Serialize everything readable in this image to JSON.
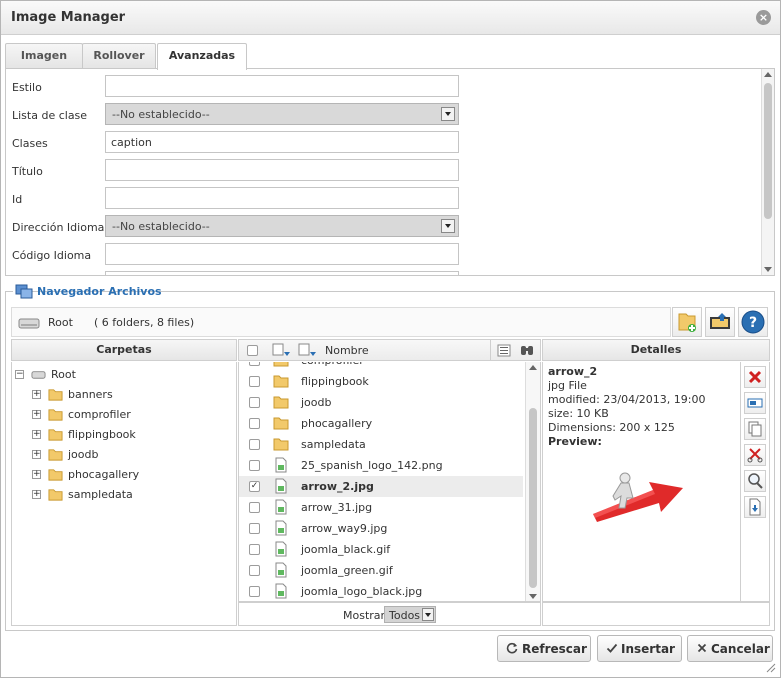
{
  "window": {
    "title": "Image Manager",
    "close_glyph": "×"
  },
  "tabs": [
    {
      "label": "Imagen"
    },
    {
      "label": "Rollover"
    },
    {
      "label": "Avanzadas"
    }
  ],
  "advanced": {
    "style_label": "Estilo",
    "style_value": "",
    "class_list_label": "Lista de clase",
    "class_list_value": "--No establecido--",
    "classes_label": "Clases",
    "classes_value": "caption",
    "title_label": "Título",
    "title_value": "",
    "id_label": "Id",
    "id_value": "",
    "lang_dir_label": "Dirección Idioma",
    "lang_dir_value": "--No establecido--",
    "lang_code_label": "Código Idioma",
    "lang_code_value": ""
  },
  "browser": {
    "legend": "Navegador Archivos",
    "path_name": "Root",
    "path_count": "( 6 folders, 8 files)"
  },
  "columns": {
    "folders": "Carpetas",
    "name": "Nombre",
    "details": "Detalles"
  },
  "tree": {
    "root": "Root",
    "folders": [
      "banners",
      "comprofiler",
      "flippingbook",
      "joodb",
      "phocagallery",
      "sampledata"
    ]
  },
  "files": [
    {
      "name": "comprofiler",
      "kind": "folder",
      "checked": false,
      "selected": false
    },
    {
      "name": "flippingbook",
      "kind": "folder",
      "checked": false,
      "selected": false
    },
    {
      "name": "joodb",
      "kind": "folder",
      "checked": false,
      "selected": false
    },
    {
      "name": "phocagallery",
      "kind": "folder",
      "checked": false,
      "selected": false
    },
    {
      "name": "sampledata",
      "kind": "folder",
      "checked": false,
      "selected": false
    },
    {
      "name": "25_spanish_logo_142.png",
      "kind": "image",
      "checked": false,
      "selected": false
    },
    {
      "name": "arrow_2.jpg",
      "kind": "image",
      "checked": true,
      "selected": true
    },
    {
      "name": "arrow_31.jpg",
      "kind": "image",
      "checked": false,
      "selected": false
    },
    {
      "name": "arrow_way9.jpg",
      "kind": "image",
      "checked": false,
      "selected": false
    },
    {
      "name": "joomla_black.gif",
      "kind": "image",
      "checked": false,
      "selected": false
    },
    {
      "name": "joomla_green.gif",
      "kind": "image",
      "checked": false,
      "selected": false
    },
    {
      "name": "joomla_logo_black.jpg",
      "kind": "image",
      "checked": false,
      "selected": false
    }
  ],
  "show": {
    "label": "Mostrar",
    "value": "Todos"
  },
  "details": {
    "name": "arrow_2",
    "type": "jpg File",
    "modified": "modified: 23/04/2013, 19:00",
    "size": "size: 10 KB",
    "dimensions": "Dimensions: 200 x 125",
    "preview_label": "Preview:"
  },
  "buttons": {
    "refresh": "Refrescar",
    "insert": "Insertar",
    "cancel": "Cancelar"
  },
  "colors": {
    "accent": "#2a6fb3",
    "delete": "#d02020",
    "preview_arrow": "#e02a2a"
  },
  "icons": {
    "close": "close-icon",
    "browser": "file-browser-icon",
    "drive": "drive-icon",
    "new_folder": "new-folder-icon",
    "upload": "upload-icon",
    "help": "help-icon",
    "folder": "folder-icon",
    "image_file": "image-file-icon"
  }
}
